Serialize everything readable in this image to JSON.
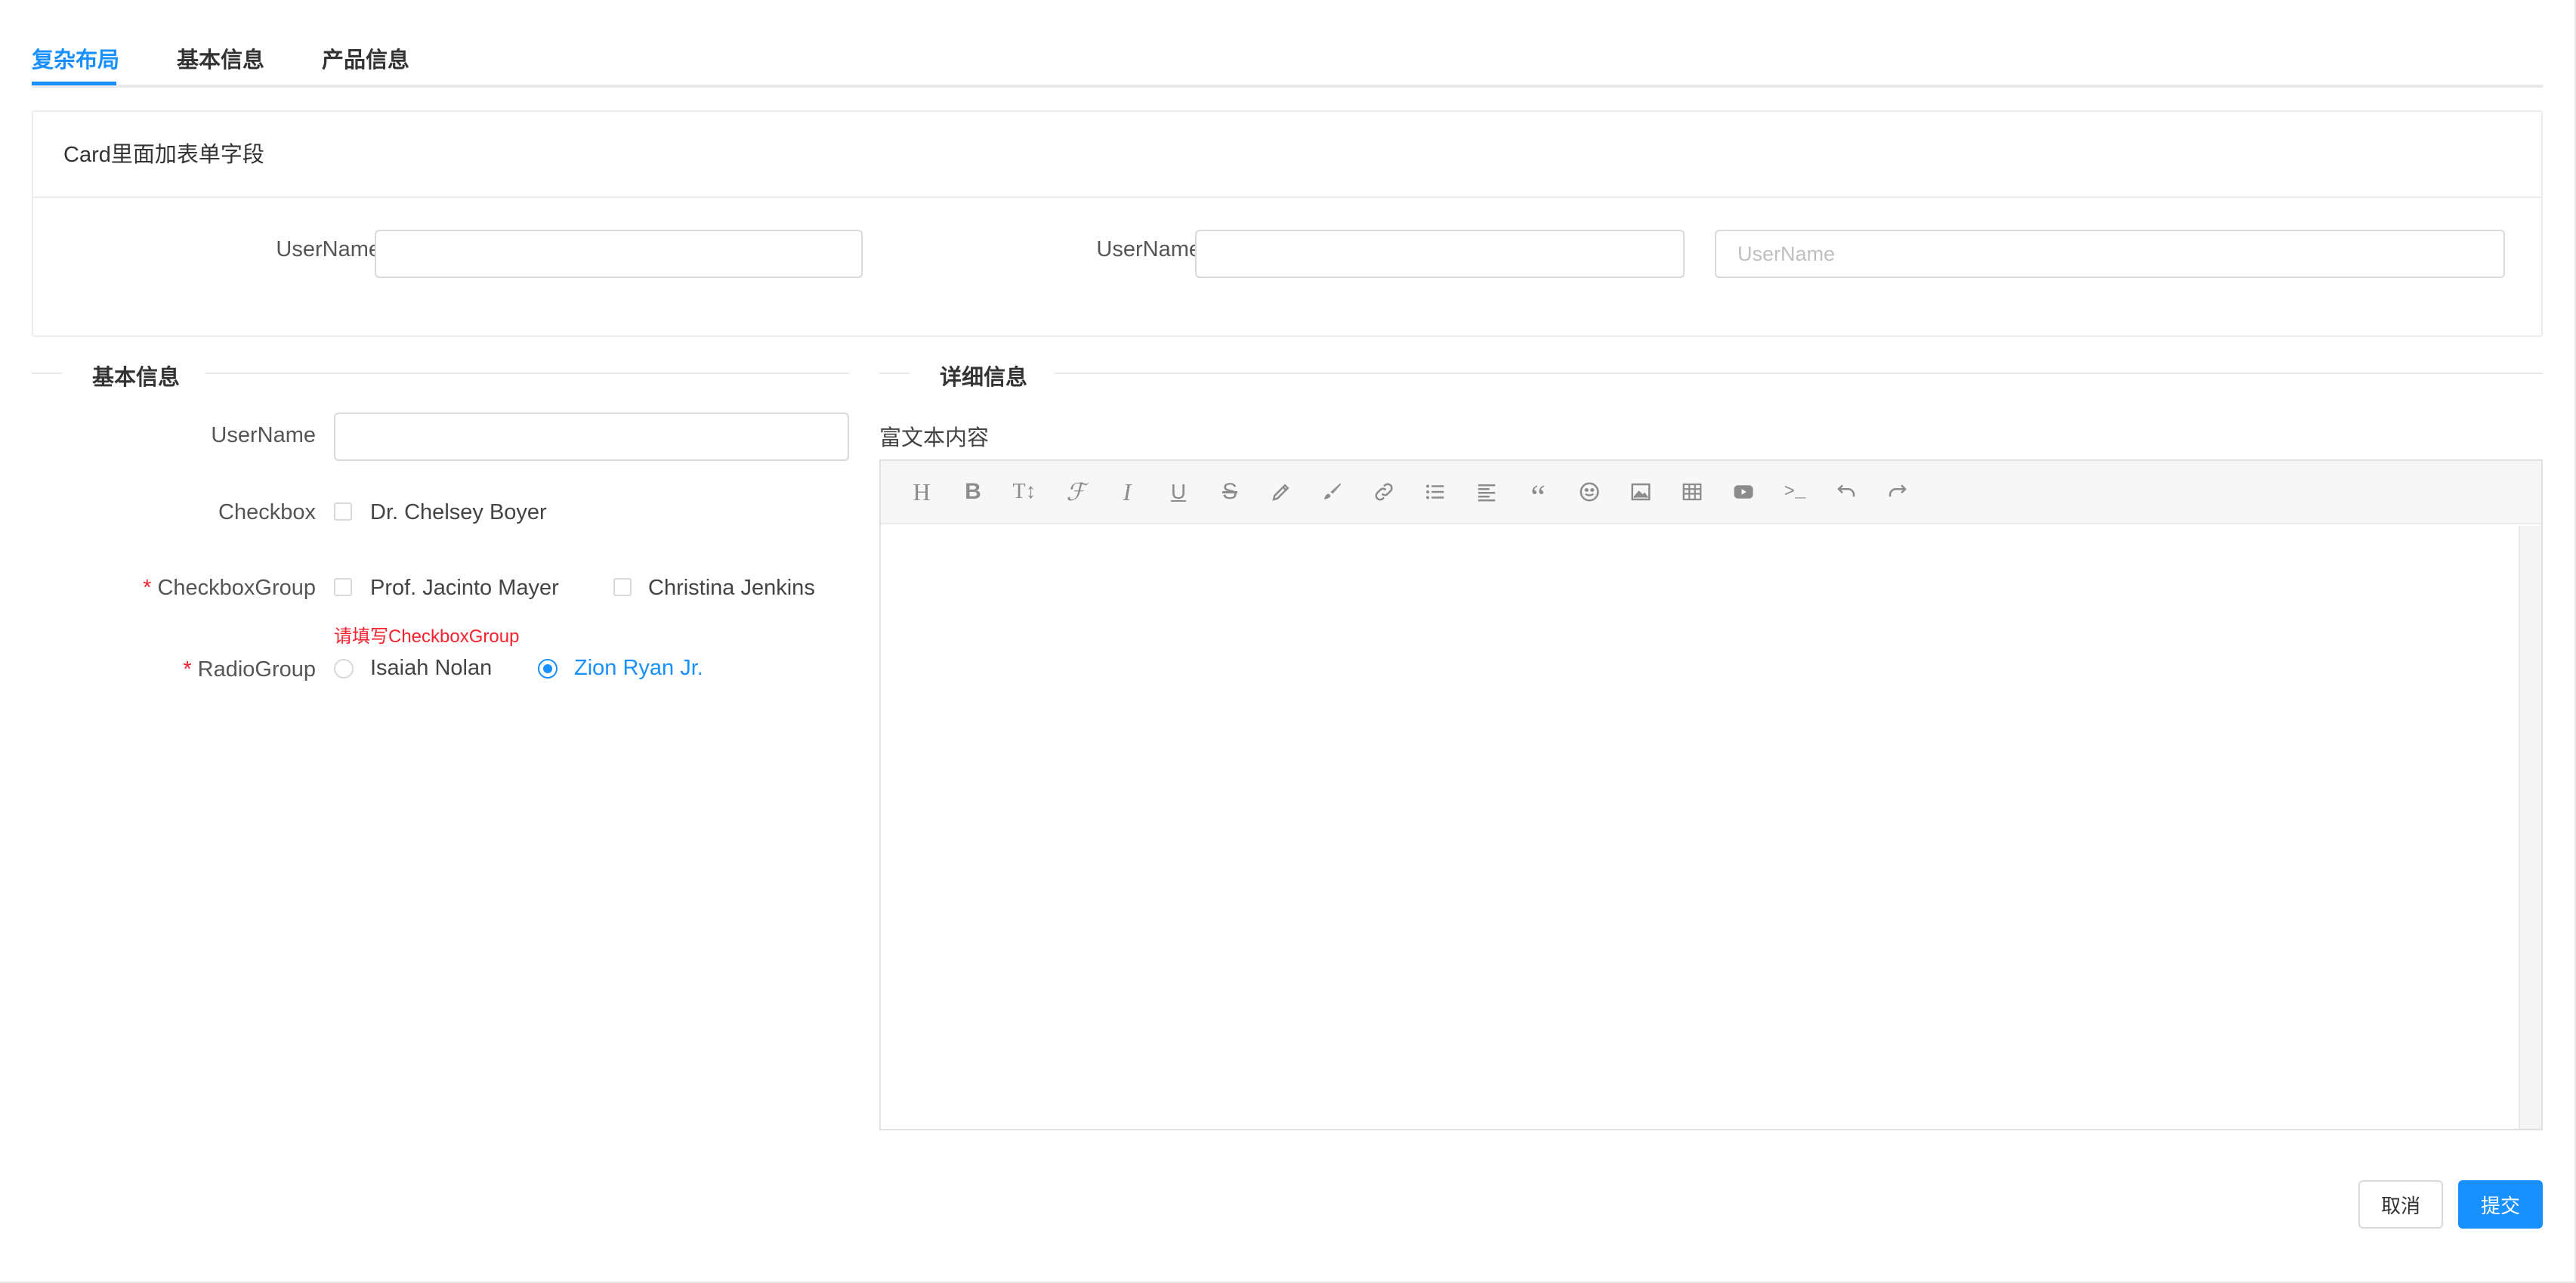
{
  "tabs": [
    {
      "label": "复杂布局",
      "active": true
    },
    {
      "label": "基本信息",
      "active": false
    },
    {
      "label": "产品信息",
      "active": false
    }
  ],
  "card": {
    "title": "Card里面加表单字段",
    "fields": [
      {
        "label": "UserName",
        "value": "",
        "placeholder": ""
      },
      {
        "label": "UserName",
        "value": "",
        "placeholder": ""
      },
      {
        "label": "",
        "value": "",
        "placeholder": "UserName"
      }
    ]
  },
  "basic_section": {
    "divider": "基本信息",
    "username": {
      "label": "UserName",
      "value": ""
    },
    "checkbox": {
      "label": "Checkbox",
      "option": "Dr. Chelsey Boyer",
      "checked": false
    },
    "checkbox_group": {
      "required_mark": "*",
      "label": "CheckboxGroup",
      "options": [
        "Prof. Jacinto Mayer",
        "Christina Jenkins"
      ],
      "error": "请填写CheckboxGroup"
    },
    "radio_group": {
      "required_mark": "*",
      "label": "RadioGroup",
      "options": [
        "Isaiah Nolan",
        "Zion Ryan Jr."
      ],
      "selected": "Zion Ryan Jr."
    }
  },
  "detail_section": {
    "divider": "详细信息",
    "editor_label": "富文本内容",
    "toolbar_icons": [
      "heading-icon",
      "bold-icon",
      "font-size-icon",
      "font-family-icon",
      "italic-icon",
      "underline-icon",
      "strikethrough-icon",
      "highlight-icon",
      "color-brush-icon",
      "link-icon",
      "list-icon",
      "align-icon",
      "quote-icon",
      "emoji-icon",
      "image-icon",
      "table-icon",
      "video-icon",
      "code-icon",
      "undo-icon",
      "redo-icon"
    ]
  },
  "actions": {
    "cancel": "取消",
    "submit": "提交"
  },
  "colors": {
    "primary": "#1890ff",
    "error": "#f5222d",
    "border": "#d9d9d9"
  }
}
